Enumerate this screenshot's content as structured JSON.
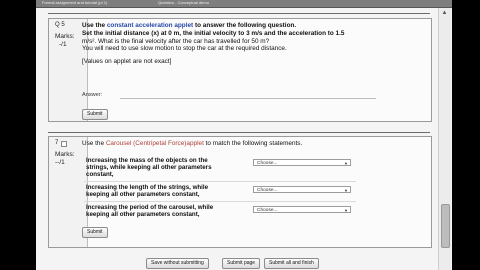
{
  "browser": {
    "tabs": [
      "Formal assignment and tutorial (pt 1)",
      "Question - Conceptual demo"
    ]
  },
  "q5": {
    "number": "Q 5",
    "marks_label": "Marks:",
    "marks_value": "-/1",
    "lines": [
      {
        "pre": "Use the ",
        "link": "constant acceleration applet",
        "post": " to answer the following question."
      },
      {
        "pre": "Set the initial distance (x) at 0 m, the initial velocity to 3 m/s and the acceleration to 1.5",
        "link": "",
        "post": ""
      }
    ],
    "line3": "m/s².  What is the final velocity after the car has travelled for 50 m?",
    "line4": "You will need to use slow motion to stop the car at the required distance.",
    "note": "[Values on applet are not exact]",
    "answer_label": "Answer:",
    "submit": "Submit"
  },
  "q7": {
    "number": "7",
    "marks_label": "Marks:",
    "marks_value": "--/1",
    "intro_pre": "Use the ",
    "intro_link": "Carousel (Centripetal Force)applet",
    "intro_post": " to match the following statements.",
    "statements": [
      {
        "lines": [
          "Increasing the mass of the objects on the",
          "strings, while keeping all other parameters",
          "constant,"
        ],
        "select": "Choose..."
      },
      {
        "lines": [
          "Increasing the length of the strings, while",
          "keeping all other parameters constant,"
        ],
        "select": "Choose..."
      },
      {
        "lines": [
          "Increasing the period of the carousel, while",
          "keeping all other parameters constant,"
        ],
        "select": "Choose..."
      }
    ],
    "submit": "Submit"
  },
  "footer": {
    "buttons": [
      "Save without submitting",
      "Submit page",
      "Submit all and finish"
    ]
  }
}
